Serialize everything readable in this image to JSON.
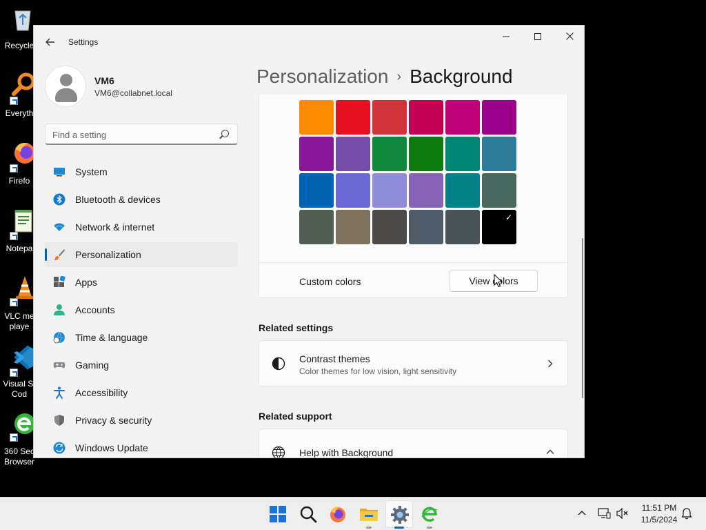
{
  "desktop": {
    "icons": [
      {
        "label": "Recycle",
        "name": "recycle-bin-icon"
      },
      {
        "label": "Everyth",
        "name": "everything-search-icon"
      },
      {
        "label": "Firefo",
        "name": "firefox-icon"
      },
      {
        "label": "Notepa",
        "name": "notepad-icon"
      },
      {
        "label": "VLC me",
        "label2": "playe",
        "name": "vlc-icon"
      },
      {
        "label": "Visual St",
        "label2": "Cod",
        "name": "vscode-icon"
      },
      {
        "label": "360 Sec",
        "label2": "Browser",
        "name": "360-browser-icon"
      }
    ]
  },
  "window": {
    "title": "Settings",
    "back_icon": "arrow-left-icon",
    "controls": [
      "minimize",
      "maximize",
      "close"
    ]
  },
  "profile": {
    "name": "VM6",
    "email": "VM6@collabnet.local"
  },
  "search": {
    "placeholder": "Find a setting"
  },
  "nav": {
    "items": [
      {
        "label": "System",
        "icon": "monitor-icon",
        "active": false
      },
      {
        "label": "Bluetooth & devices",
        "icon": "bluetooth-icon",
        "active": false
      },
      {
        "label": "Network & internet",
        "icon": "wifi-icon",
        "active": false
      },
      {
        "label": "Personalization",
        "icon": "brush-icon",
        "active": true
      },
      {
        "label": "Apps",
        "icon": "apps-icon",
        "active": false
      },
      {
        "label": "Accounts",
        "icon": "person-icon",
        "active": false
      },
      {
        "label": "Time & language",
        "icon": "globe-clock-icon",
        "active": false
      },
      {
        "label": "Gaming",
        "icon": "gamepad-icon",
        "active": false
      },
      {
        "label": "Accessibility",
        "icon": "accessibility-icon",
        "active": false
      },
      {
        "label": "Privacy & security",
        "icon": "shield-icon",
        "active": false
      },
      {
        "label": "Windows Update",
        "icon": "update-icon",
        "active": false
      }
    ]
  },
  "breadcrumb": {
    "parent": "Personalization",
    "separator": "›",
    "current": "Background"
  },
  "colors": {
    "rows": [
      [
        "#ff8c00",
        "#e81123",
        "#d13438",
        "#c30052",
        "#bf0077",
        "#9a0089"
      ],
      [
        "#881798",
        "#744da9",
        "#10893e",
        "#107c10",
        "#018574",
        "#2d7d9a"
      ],
      [
        "#0063b1",
        "#6b69d6",
        "#8e8cd8",
        "#8764b8",
        "#038387",
        "#486860"
      ],
      [
        "#525e54",
        "#7e735f",
        "#4c4a48",
        "#515c6b",
        "#4a5459",
        "#000000"
      ]
    ],
    "selected": "#000000",
    "check_glyph": "✓"
  },
  "custom_colors": {
    "label": "Custom colors",
    "button": "View colors"
  },
  "related_settings": {
    "title": "Related settings",
    "items": [
      {
        "title": "Contrast themes",
        "subtitle": "Color themes for low vision, light sensitivity",
        "icon": "contrast-icon"
      }
    ]
  },
  "related_support": {
    "title": "Related support",
    "items": [
      {
        "title": "Help with Background",
        "icon": "globe-icon"
      }
    ]
  },
  "taskbar": {
    "apps": [
      "start-icon",
      "search-icon",
      "firefox-icon",
      "file-explorer-icon",
      "settings-icon",
      "360-browser-icon"
    ],
    "time": "11:51 PM",
    "date": "11/5/2024"
  }
}
